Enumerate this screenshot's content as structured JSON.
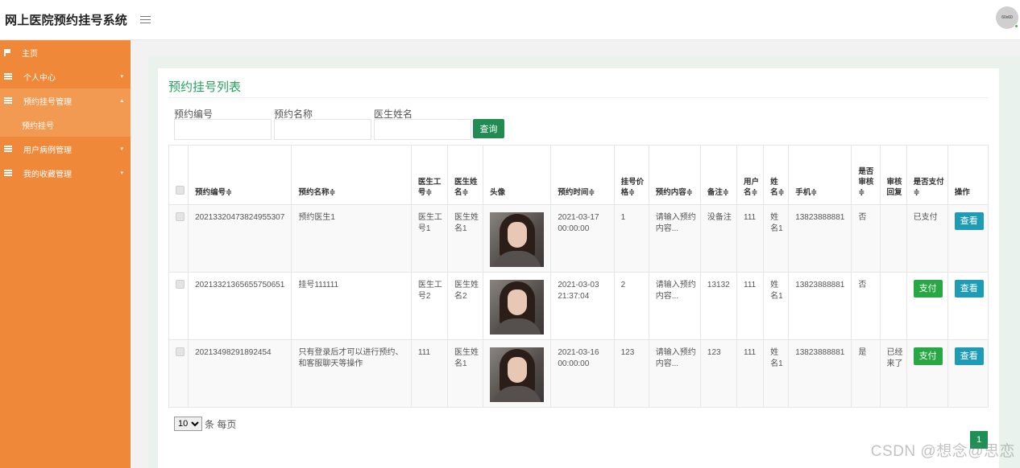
{
  "app": {
    "title": "网上医院预约挂号系统",
    "avatar_text": "60x60"
  },
  "sidebar": {
    "items": [
      {
        "label": "主页",
        "icon": "flag-icon"
      },
      {
        "label": "个人中心",
        "icon": "grid-icon",
        "arrow": "▾"
      },
      {
        "label": "预约挂号管理",
        "icon": "grid-icon",
        "arrow": "▴"
      },
      {
        "label": "预约挂号"
      },
      {
        "label": "用户病例管理",
        "icon": "grid-icon",
        "arrow": "▾"
      },
      {
        "label": "我的收藏管理",
        "icon": "grid-icon",
        "arrow": "▾"
      }
    ]
  },
  "page": {
    "title": "预约挂号列表",
    "filters": {
      "no_label": "预约编号",
      "name_label": "预约名称",
      "doctor_label": "医生姓名",
      "search_button": "查询"
    }
  },
  "table": {
    "headers": [
      "预约编号≑",
      "预约名称≑",
      "医生工号≑",
      "医生姓名≑",
      "头像",
      "预约时间≑",
      "挂号价格≑",
      "预约内容≑",
      "备注≑",
      "用户名≑",
      "姓名≑",
      "手机≑",
      "是否审核≑",
      "审核回复",
      "是否支付≑",
      "操作"
    ],
    "rows": [
      {
        "no": "20213320473824955307",
        "name": "预约医生1",
        "doc_id": "医生工号1",
        "doc_name": "医生姓名1",
        "time": "2021-03-17 00:00:00",
        "price": "1",
        "content": "请输入预约内容...",
        "remark": "没备注",
        "username": "111",
        "realname": "姓名1",
        "phone": "13823888881",
        "audited": "否",
        "reply": "",
        "paid": "已支付",
        "view": "查看"
      },
      {
        "no": "20213321365655750651",
        "name": "挂号111111",
        "doc_id": "医生工号2",
        "doc_name": "医生姓名2",
        "time": "2021-03-03 21:37:04",
        "price": "2",
        "content": "请输入预约内容...",
        "remark": "13132",
        "username": "111",
        "realname": "姓名1",
        "phone": "13823888881",
        "audited": "否",
        "reply": "",
        "pay": "支付",
        "view": "查看"
      },
      {
        "no": "20213498291892454",
        "name": "只有登录后才可以进行预约、和客服聊天等操作",
        "doc_id": "111",
        "doc_name": "医生姓名1",
        "time": "2021-03-16 00:00:00",
        "price": "123",
        "content": "请输入预约内容...",
        "remark": "123",
        "username": "111",
        "realname": "姓名1",
        "phone": "13823888881",
        "audited": "是",
        "reply": "已经来了",
        "pay": "支付",
        "view": "查看"
      }
    ]
  },
  "pagination": {
    "page_size": "10",
    "per_page_text": "条 每页",
    "current_page": "1"
  },
  "watermark": "CSDN @想念@思恋",
  "colors": {
    "sidebar": "#f0883a",
    "accent_green": "#27a160",
    "search_button": "#218b52",
    "pay_button": "#28a745",
    "view_button": "#1f9cb5"
  }
}
